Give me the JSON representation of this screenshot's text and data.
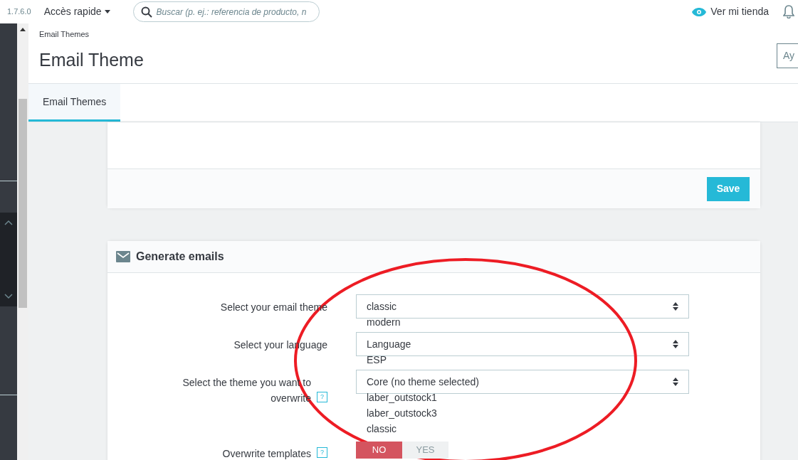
{
  "topbar": {
    "version": "1.7.6.0",
    "quick_access": "Accès rapide",
    "search": {
      "placeholder": "Buscar (p. ej.: referencia de producto, n"
    },
    "view_store": "Ver mi tienda"
  },
  "header": {
    "breadcrumb": "Email Themes",
    "title": "Email Theme",
    "help_button": "Ay"
  },
  "tabs": [
    {
      "label": "Email Themes",
      "selected": true
    }
  ],
  "settings_card": {
    "save_button": "Save"
  },
  "generate_card": {
    "title": "Generate emails",
    "fields": [
      {
        "kind": "select",
        "label": "Select your email theme",
        "value": "classic",
        "options": [
          "modern"
        ]
      },
      {
        "kind": "select",
        "label": "Select your language",
        "value": "Language",
        "options": [
          "ESP"
        ]
      },
      {
        "kind": "select",
        "label": "Select the theme you want to overwrite",
        "help": "?",
        "value": "Core (no theme selected)",
        "options": [
          "laber_outstock1",
          "laber_outstock3",
          "classic"
        ]
      },
      {
        "kind": "toggle",
        "label": "Overwrite templates",
        "help": "?",
        "options": [
          {
            "label": "NO",
            "selected": true
          },
          {
            "label": "YES",
            "selected": false
          }
        ]
      }
    ]
  }
}
